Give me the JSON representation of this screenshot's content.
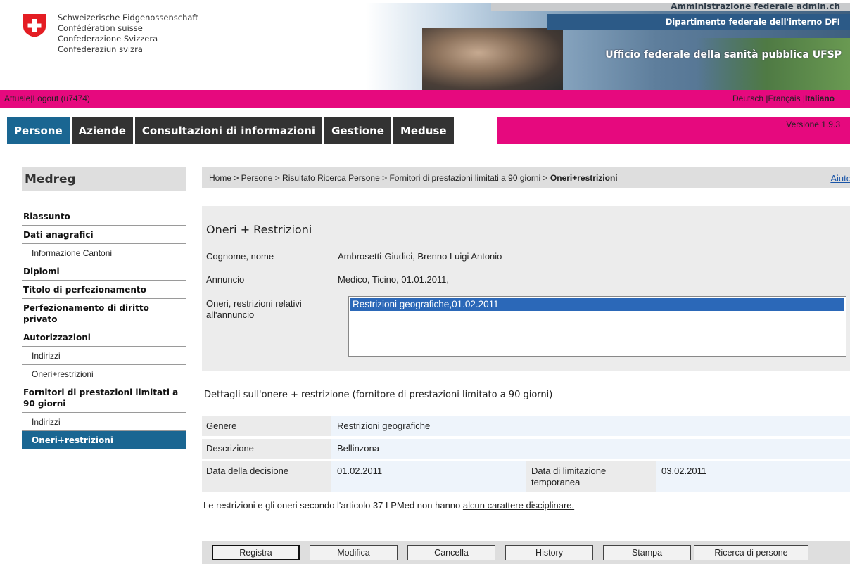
{
  "header": {
    "confederation": [
      "Schweizerische Eidgenossenschaft",
      "Confédération suisse",
      "Confederazione Svizzera",
      "Confederaziun svizra"
    ],
    "admin": "Amministrazione federale admin.ch",
    "department": "Dipartimento federale dell'interno DFI",
    "office": "Ufficio federale della sanità pubblica UFSP"
  },
  "topbar": {
    "actual": "Attuale",
    "separator": "|",
    "logout": "Logout (u7474)",
    "languages": [
      "Deutsch",
      "Français",
      "Italiano"
    ],
    "active_language": "Italiano"
  },
  "nav": {
    "tabs": [
      "Persone",
      "Aziende",
      "Consultazioni di informazioni",
      "Gestione",
      "Meduse"
    ],
    "active": "Persone",
    "version": "Versione 1.9.3"
  },
  "sidebar": {
    "title": "Medreg",
    "items": [
      {
        "label": "Riassunto",
        "level": 0
      },
      {
        "label": "Dati anagrafici",
        "level": 0
      },
      {
        "label": "Informazione Cantoni",
        "level": 1
      },
      {
        "label": "Diplomi",
        "level": 0
      },
      {
        "label": "Titolo di perfezionamento",
        "level": 0
      },
      {
        "label": "Perfezionamento di diritto privato",
        "level": 0
      },
      {
        "label": "Autorizzazioni",
        "level": 0
      },
      {
        "label": "Indirizzi",
        "level": 1
      },
      {
        "label": "Oneri+restrizioni",
        "level": 1
      },
      {
        "label": "Fornitori di prestazioni limitati a 90 giorni",
        "level": 0
      },
      {
        "label": "Indirizzi",
        "level": 1
      },
      {
        "label": "Oneri+restrizioni",
        "level": 1,
        "active": true
      }
    ]
  },
  "breadcrumb": {
    "path": "Home > Persone > Risultato Ricerca Persone > Fornitori di prestazioni limitati a 90 giorni > ",
    "current": "Oneri+restrizioni",
    "help": "Aiuto"
  },
  "panel": {
    "title": "Oneri + Restrizioni",
    "name_label": "Cognome, nome",
    "name_value": "Ambrosetti-Giudici, Brenno Luigi Antonio",
    "announcement_label": "Annuncio",
    "announcement_value": "Medico, Ticino, 01.01.2011,",
    "restrictions_label": "Oneri, restrizioni relativi all'annuncio",
    "restrictions_options": [
      "Restrizioni geografiche,01.02.2011"
    ]
  },
  "details": {
    "title": "Dettagli sull'onere + restrizione (fornitore di prestazioni limitato a 90 giorni)",
    "genre_label": "Genere",
    "genre_value": "Restrizioni geografiche",
    "description_label": "Descrizione",
    "description_value": "Bellinzona",
    "decision_date_label": "Data della decisione",
    "decision_date_value": "01.02.2011",
    "limit_date_label": "Data di limitazione temporanea",
    "limit_date_value": "03.02.2011"
  },
  "note": {
    "text": "Le restrizioni e gli oneri secondo l'articolo 37 LPMed non hanno ",
    "link": "alcun carattere disciplinare."
  },
  "buttons": {
    "save": "Registra",
    "edit": "Modifica",
    "delete": "Cancella",
    "history": "History",
    "print": "Stampa",
    "search": "Ricerca di persone"
  },
  "colors": {
    "accent_pink": "#e6097e",
    "nav_active": "#1a6692",
    "nav_dark": "#333333",
    "selection": "#2b68b8"
  }
}
